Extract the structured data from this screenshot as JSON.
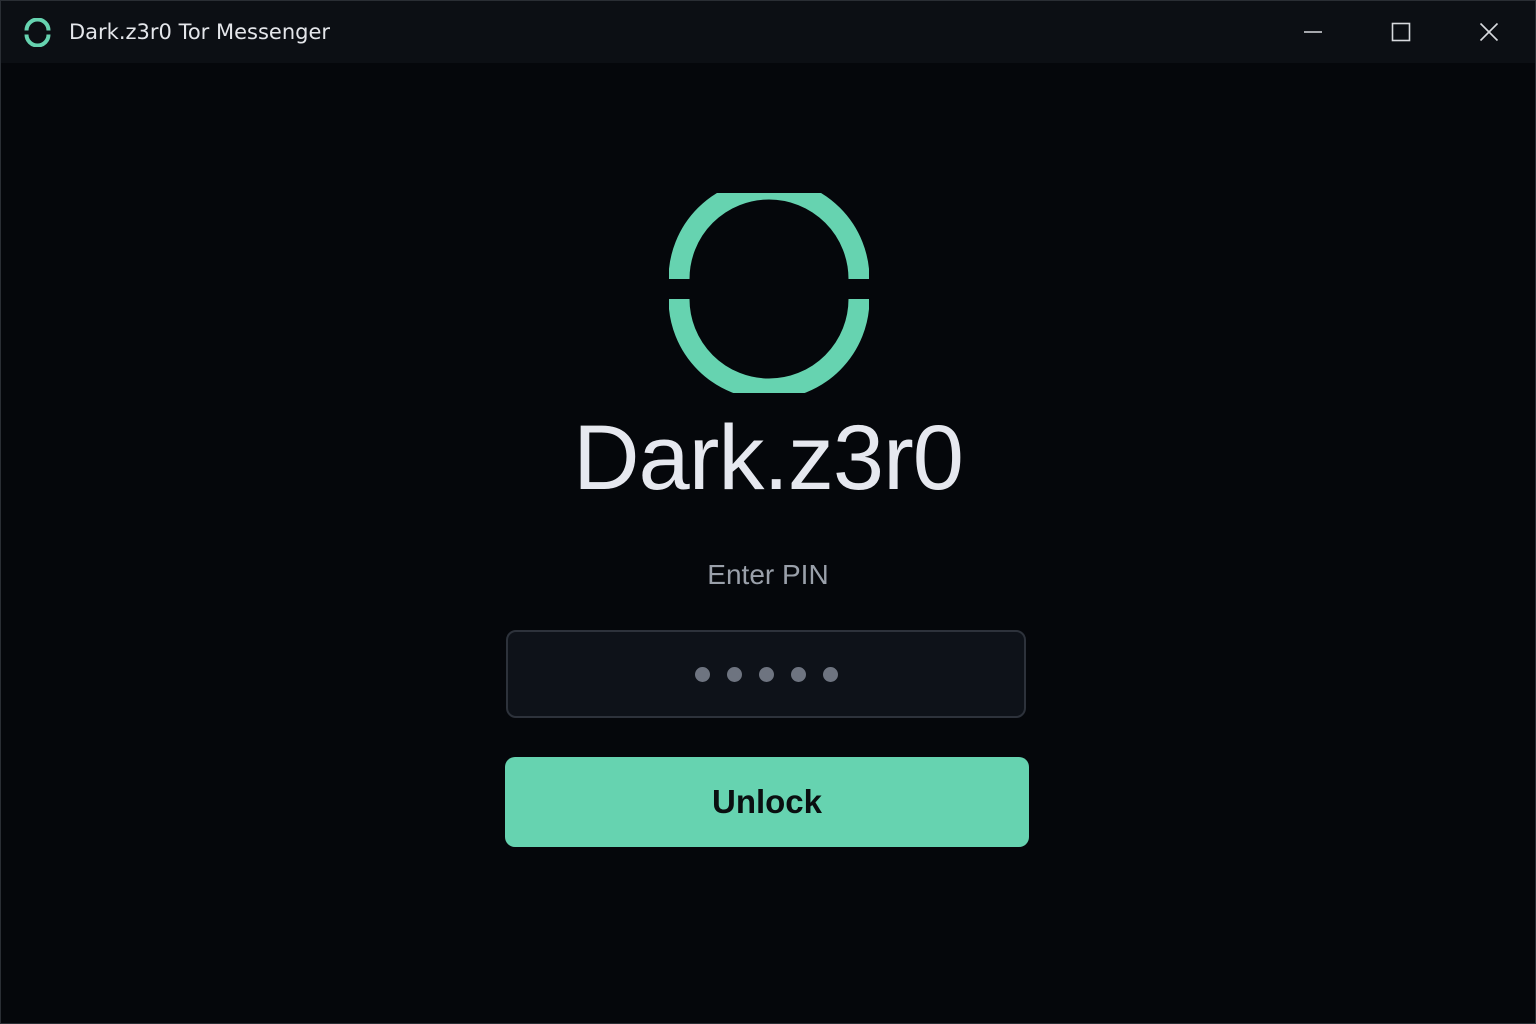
{
  "window": {
    "title": "Dark.z3r0 Tor Messenger",
    "app_icon": "ring-logo-icon",
    "controls": {
      "minimize_icon": "minimize-icon",
      "maximize_icon": "maximize-icon",
      "close_icon": "close-icon"
    }
  },
  "lock_screen": {
    "logo_icon": "ring-logo-icon",
    "app_name": "Dark.z3r0",
    "pin_label": "Enter PIN",
    "pin_digits_entered": 5,
    "unlock_label": "Unlock"
  },
  "colors": {
    "accent": "#66d3b0",
    "background": "#05070b",
    "titlebar": "#0c0f14",
    "text_primary": "#e6e8ef",
    "text_secondary": "#9aa0aa"
  }
}
